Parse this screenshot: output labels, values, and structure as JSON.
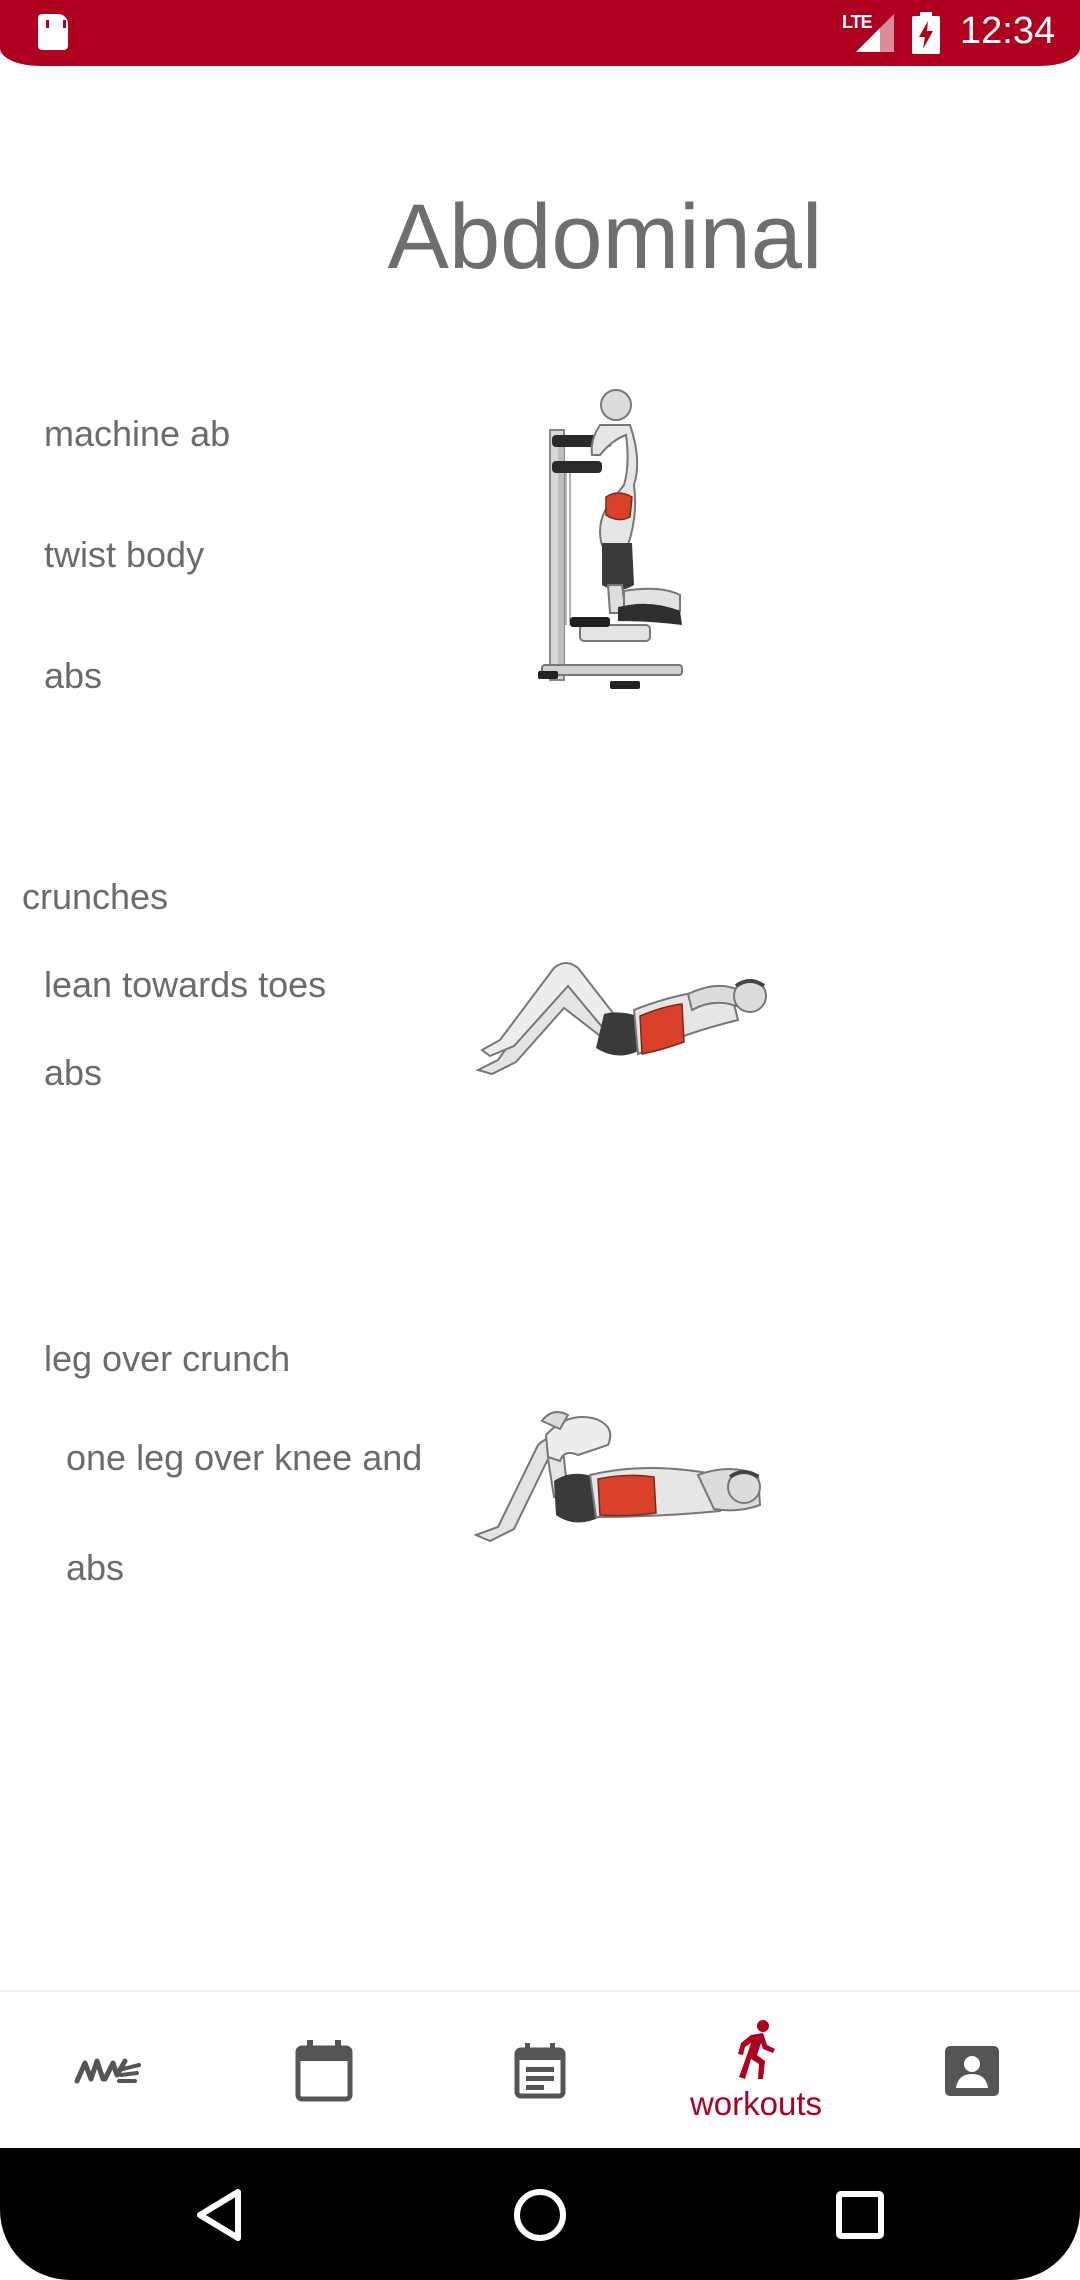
{
  "status_bar": {
    "network": "LTE",
    "time": "12:34",
    "icons": [
      "sd-card-icon",
      "signal-icon",
      "battery-charging-icon"
    ]
  },
  "page": {
    "title": "Abdominal"
  },
  "exercises": [
    {
      "labels": [
        "machine ab",
        "twist body",
        "abs"
      ],
      "image": "machine-ab-crunch-figure"
    },
    {
      "labels": [
        "crunches",
        "lean towards toes",
        "abs"
      ],
      "image": "crunch-figure"
    },
    {
      "labels": [
        "leg over crunch",
        "one leg over knee and",
        "abs"
      ],
      "image": "leg-over-crunch-figure"
    }
  ],
  "bottom_nav": {
    "items": [
      {
        "name": "logo",
        "icon": "brand-logo-icon",
        "label": ""
      },
      {
        "name": "calendar",
        "icon": "calendar-icon",
        "label": ""
      },
      {
        "name": "schedule",
        "icon": "event-note-icon",
        "label": ""
      },
      {
        "name": "workouts",
        "icon": "running-icon",
        "label": "workouts",
        "active": true
      },
      {
        "name": "profile",
        "icon": "contact-card-icon",
        "label": ""
      }
    ],
    "active_color": "#b00020",
    "inactive_color": "#555555"
  },
  "system_nav": {
    "buttons": [
      "back-icon",
      "home-icon",
      "recents-icon"
    ]
  },
  "colors": {
    "accent": "#b00020",
    "text": "#6b6b6b",
    "muscle_highlight": "#d9412b"
  }
}
